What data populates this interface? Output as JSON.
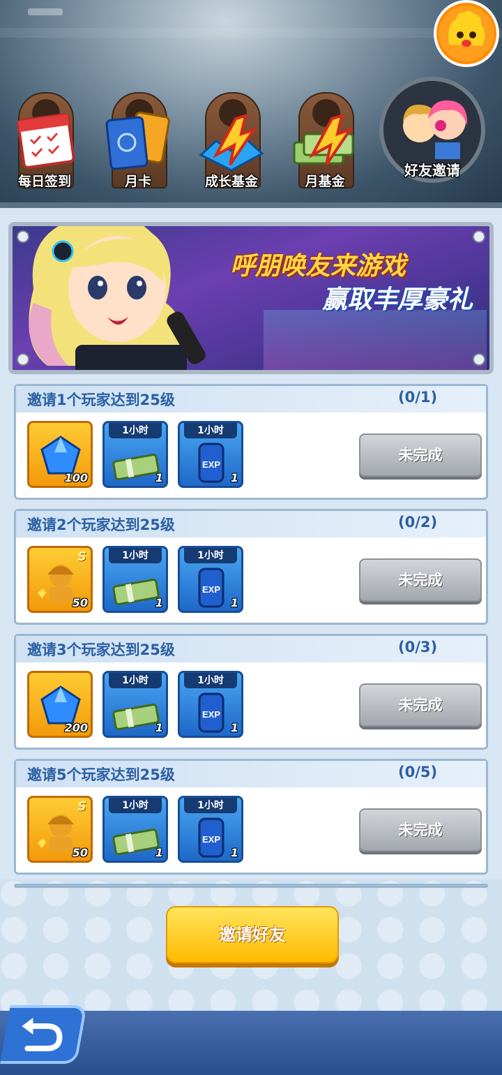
{
  "tabs": [
    {
      "label": "每日签到",
      "icon": "calendar-icon"
    },
    {
      "label": "月卡",
      "icon": "card-icon"
    },
    {
      "label": "成长基金",
      "icon": "gem-fund-icon"
    },
    {
      "label": "月基金",
      "icon": "cash-fund-icon"
    }
  ],
  "active_tab": {
    "label": "好友邀请",
    "icon": "friends-icon"
  },
  "banner": {
    "line1": "呼朋唤友来游戏",
    "line2": "赢取丰厚豪礼"
  },
  "tasks": [
    {
      "title": "邀请1个玩家达到25级",
      "progress": "(0/1)",
      "status": "未完成",
      "rewards": [
        {
          "icon": "diamond-icon",
          "count": "100",
          "tag": ""
        },
        {
          "icon": "cash-icon",
          "count": "1",
          "tag": "1小时"
        },
        {
          "icon": "exp-can-icon",
          "count": "1",
          "tag": "1小时"
        }
      ]
    },
    {
      "title": "邀请2个玩家达到25级",
      "progress": "(0/2)",
      "status": "未完成",
      "rewards": [
        {
          "icon": "character-shard-icon",
          "count": "50",
          "tag": "",
          "grade": "S"
        },
        {
          "icon": "cash-icon",
          "count": "1",
          "tag": "1小时"
        },
        {
          "icon": "exp-can-icon",
          "count": "1",
          "tag": "1小时"
        }
      ]
    },
    {
      "title": "邀请3个玩家达到25级",
      "progress": "(0/3)",
      "status": "未完成",
      "rewards": [
        {
          "icon": "diamond-icon",
          "count": "200",
          "tag": ""
        },
        {
          "icon": "cash-icon",
          "count": "1",
          "tag": "1小时"
        },
        {
          "icon": "exp-can-icon",
          "count": "1",
          "tag": "1小时"
        }
      ]
    },
    {
      "title": "邀请5个玩家达到25级",
      "progress": "(0/5)",
      "status": "未完成",
      "rewards": [
        {
          "icon": "character-shard-icon",
          "count": "50",
          "tag": "",
          "grade": "S"
        },
        {
          "icon": "cash-icon",
          "count": "1",
          "tag": "1小时"
        },
        {
          "icon": "exp-can-icon",
          "count": "1",
          "tag": "1小时"
        }
      ]
    }
  ],
  "invite_button": "邀请好友",
  "colors": {
    "accent_yellow": "#ffbb00",
    "title_blue": "#2a5fa3",
    "button_gray": "#a3a8ae"
  }
}
